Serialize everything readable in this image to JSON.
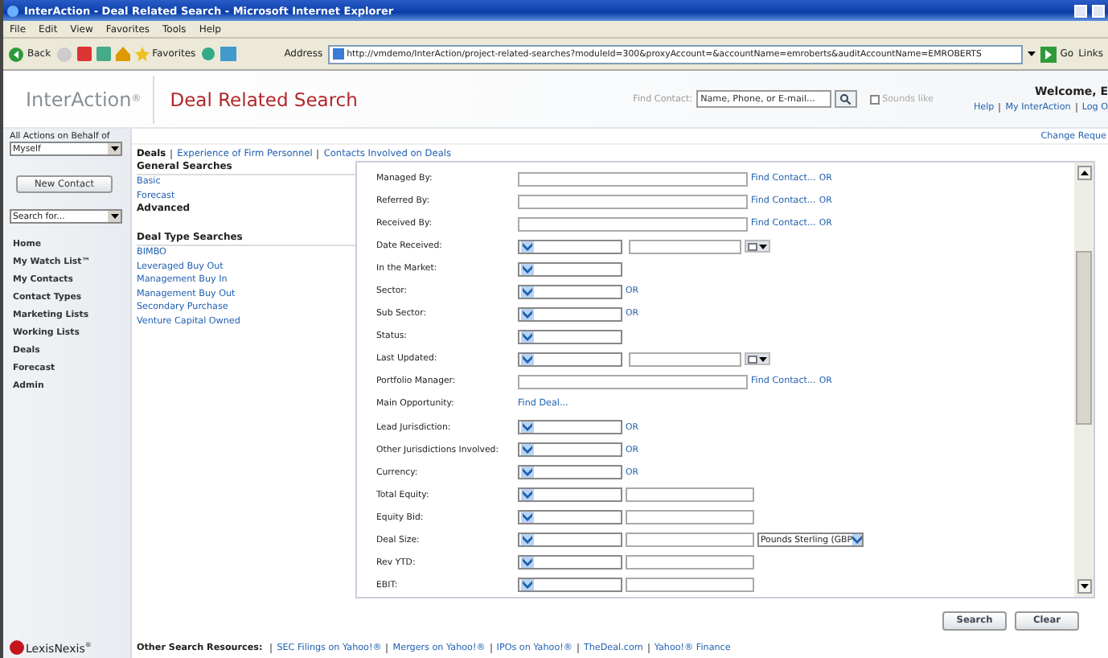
{
  "window": {
    "title": "InterAction - Deal Related Search - Microsoft Internet Explorer"
  },
  "menu": [
    "File",
    "Edit",
    "View",
    "Favorites",
    "Tools",
    "Help"
  ],
  "toolbar": {
    "back": "Back",
    "favorites": "Favorites",
    "address_label": "Address",
    "url": "http://vmdemo/InterAction/project-related-searches?moduleId=300&proxyAccount=&accountName=emroberts&auditAccountName=EMROBERTS",
    "go": "Go",
    "links": "Links"
  },
  "header": {
    "logo": "InterAction$^{®}$",
    "page_title": "Deal Related Search",
    "find_contact_label": "Find Contact:",
    "find_contact_placeholder": "Name, Phone, or E-mail...",
    "sounds_like": {
      "label": "Sounds like",
      "checked": false
    },
    "welcome": "Welcome, E",
    "user_links": [
      "Help",
      "My InterAction",
      "Log O"
    ],
    "change_request": "Change Reque"
  },
  "sidebar": {
    "behalf_label": "All Actions on Behalf of",
    "behalf_value": "Myself",
    "new_contact": "New Contact",
    "search_for": "Search for...",
    "items": [
      "Home",
      "My Watch List™",
      "My Contacts",
      "Contact Types",
      "Marketing Lists",
      "Working Lists",
      "Deals",
      "Forecast",
      "Admin"
    ]
  },
  "tabs": [
    {
      "label": "Deals",
      "selected": true
    },
    {
      "label": "Experience of Firm Personnel",
      "selected": false
    },
    {
      "label": "Contacts Involved on Deals",
      "selected": false
    }
  ],
  "search_list": [
    {
      "kind": "section",
      "text": "General Searches"
    },
    {
      "kind": "link",
      "text": "Basic"
    },
    {
      "kind": "link",
      "text": "Forecast"
    },
    {
      "kind": "heading",
      "text": "Advanced"
    },
    {
      "kind": "section",
      "text": "Deal Type Searches"
    },
    {
      "kind": "link",
      "text": "BIMBO"
    },
    {
      "kind": "link",
      "text": "Leveraged Buy Out"
    },
    {
      "kind": "link",
      "text": "Management Buy In"
    },
    {
      "kind": "link",
      "text": "Management Buy Out"
    },
    {
      "kind": "link",
      "text": "Secondary Purchase"
    },
    {
      "kind": "link",
      "text": "Venture Capital Owned"
    }
  ],
  "form_rows": [
    {
      "label": "Managed By:",
      "kind": "contact",
      "link": "Find Contact...",
      "or": "OR"
    },
    {
      "label": "Referred By:",
      "kind": "contact",
      "link": "Find Contact...",
      "or": "OR"
    },
    {
      "label": "Received By:",
      "kind": "contact",
      "link": "Find Contact...",
      "or": "OR"
    },
    {
      "label": "Date Received:",
      "kind": "date"
    },
    {
      "label": "In the Market:",
      "kind": "select"
    },
    {
      "label": "Sector:",
      "kind": "select",
      "or": "OR"
    },
    {
      "label": "Sub Sector:",
      "kind": "select",
      "or": "OR"
    },
    {
      "label": "Status:",
      "kind": "select"
    },
    {
      "label": "Last Updated:",
      "kind": "date"
    },
    {
      "label": "Portfolio Manager:",
      "kind": "contact",
      "link": "Find Contact...",
      "or": "OR"
    },
    {
      "label": "Main Opportunity:",
      "kind": "link",
      "link": "Find Deal..."
    },
    {
      "label": "Lead Jurisdiction:",
      "kind": "select",
      "or": "OR"
    },
    {
      "label": "Other Jurisdictions Involved:",
      "kind": "select",
      "or": "OR"
    },
    {
      "label": "Currency:",
      "kind": "select",
      "or": "OR"
    },
    {
      "label": "Total Equity:",
      "kind": "amount"
    },
    {
      "label": "Equity Bid:",
      "kind": "amount"
    },
    {
      "label": "Deal Size:",
      "kind": "amount",
      "currency": "Pounds Sterling (GBP"
    },
    {
      "label": "Rev YTD:",
      "kind": "amount"
    },
    {
      "label": "EBIT:",
      "kind": "amount"
    }
  ],
  "buttons": [
    "Search",
    "Clear"
  ],
  "footer": {
    "logo": "LexisNexis$^{®}$",
    "label": "Other Search Resources:",
    "links": [
      "SEC Filings on Yahoo!®",
      "Mergers on Yahoo!®",
      "IPOs on Yahoo!®",
      "TheDeal.com",
      "Yahoo!® Finance"
    ]
  }
}
